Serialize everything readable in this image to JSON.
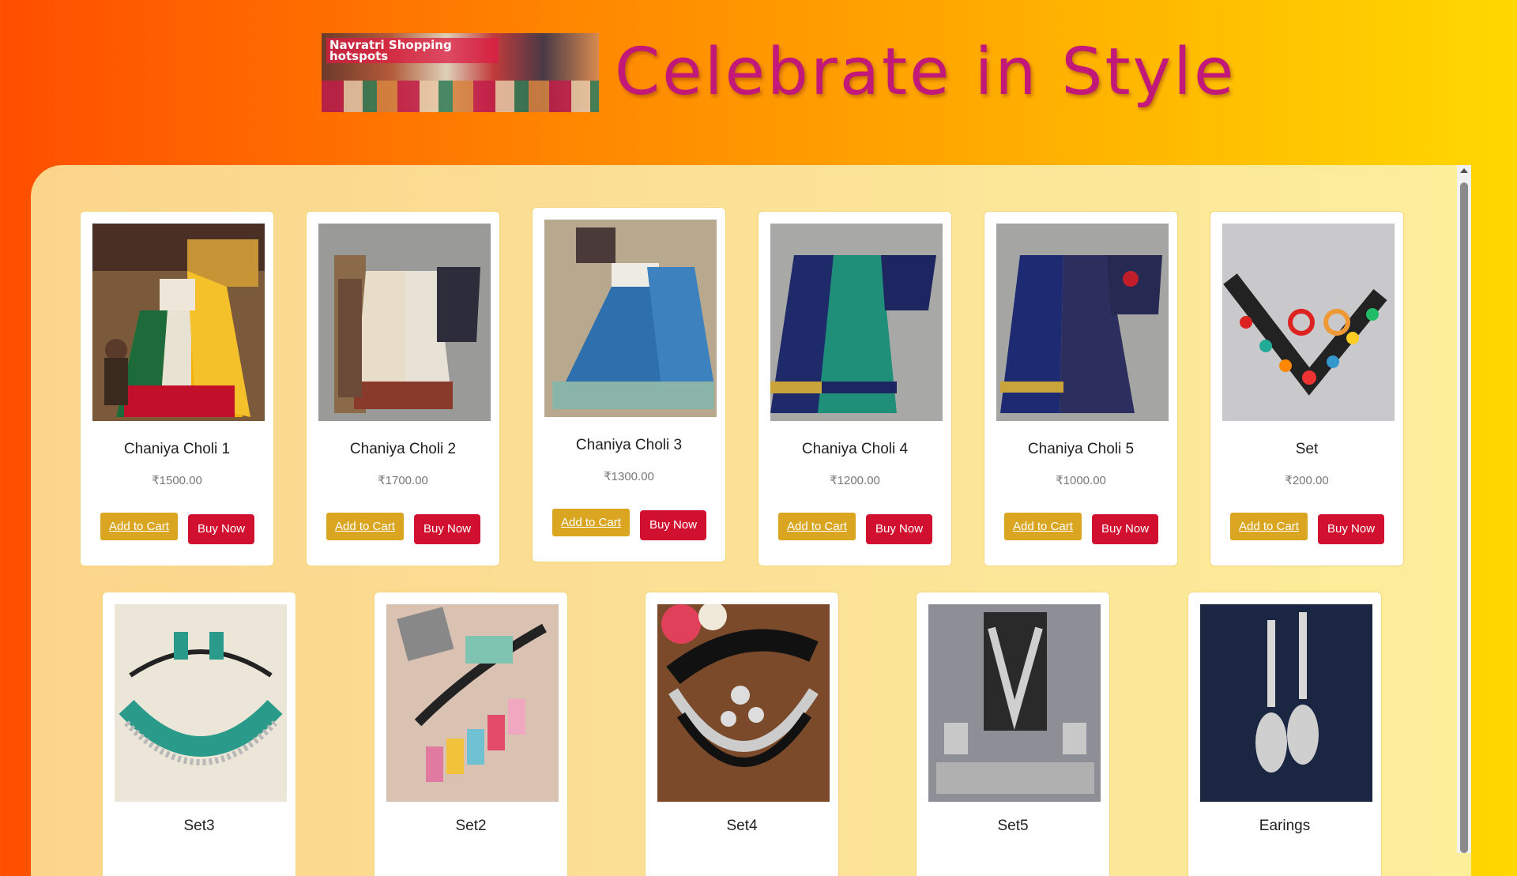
{
  "header": {
    "title": "Celebrate in Style",
    "banner_text": "Navratri Shopping hotspots"
  },
  "products_row1": [
    {
      "name": "Chaniya Choli 1",
      "price": "₹1500.00",
      "cart_label": "Add to Cart",
      "buy_label": "Buy Now"
    },
    {
      "name": "Chaniya Choli 2",
      "price": "₹1700.00",
      "cart_label": "Add to Cart",
      "buy_label": "Buy Now"
    },
    {
      "name": "Chaniya Choli 3",
      "price": "₹1300.00",
      "cart_label": "Add to Cart",
      "buy_label": "Buy Now"
    },
    {
      "name": "Chaniya Choli 4",
      "price": "₹1200.00",
      "cart_label": "Add to Cart",
      "buy_label": "Buy Now"
    },
    {
      "name": "Chaniya Choli 5",
      "price": "₹1000.00",
      "cart_label": "Add to Cart",
      "buy_label": "Buy Now"
    },
    {
      "name": "Set",
      "price": "₹200.00",
      "cart_label": "Add to Cart",
      "buy_label": "Buy Now"
    }
  ],
  "products_row2": [
    {
      "name": "Set3"
    },
    {
      "name": "Set2"
    },
    {
      "name": "Set4"
    },
    {
      "name": "Set5"
    },
    {
      "name": "Earings"
    }
  ],
  "colors": {
    "title": "#c2187a",
    "add_to_cart": "#daa520",
    "buy_now": "#d1102f"
  }
}
